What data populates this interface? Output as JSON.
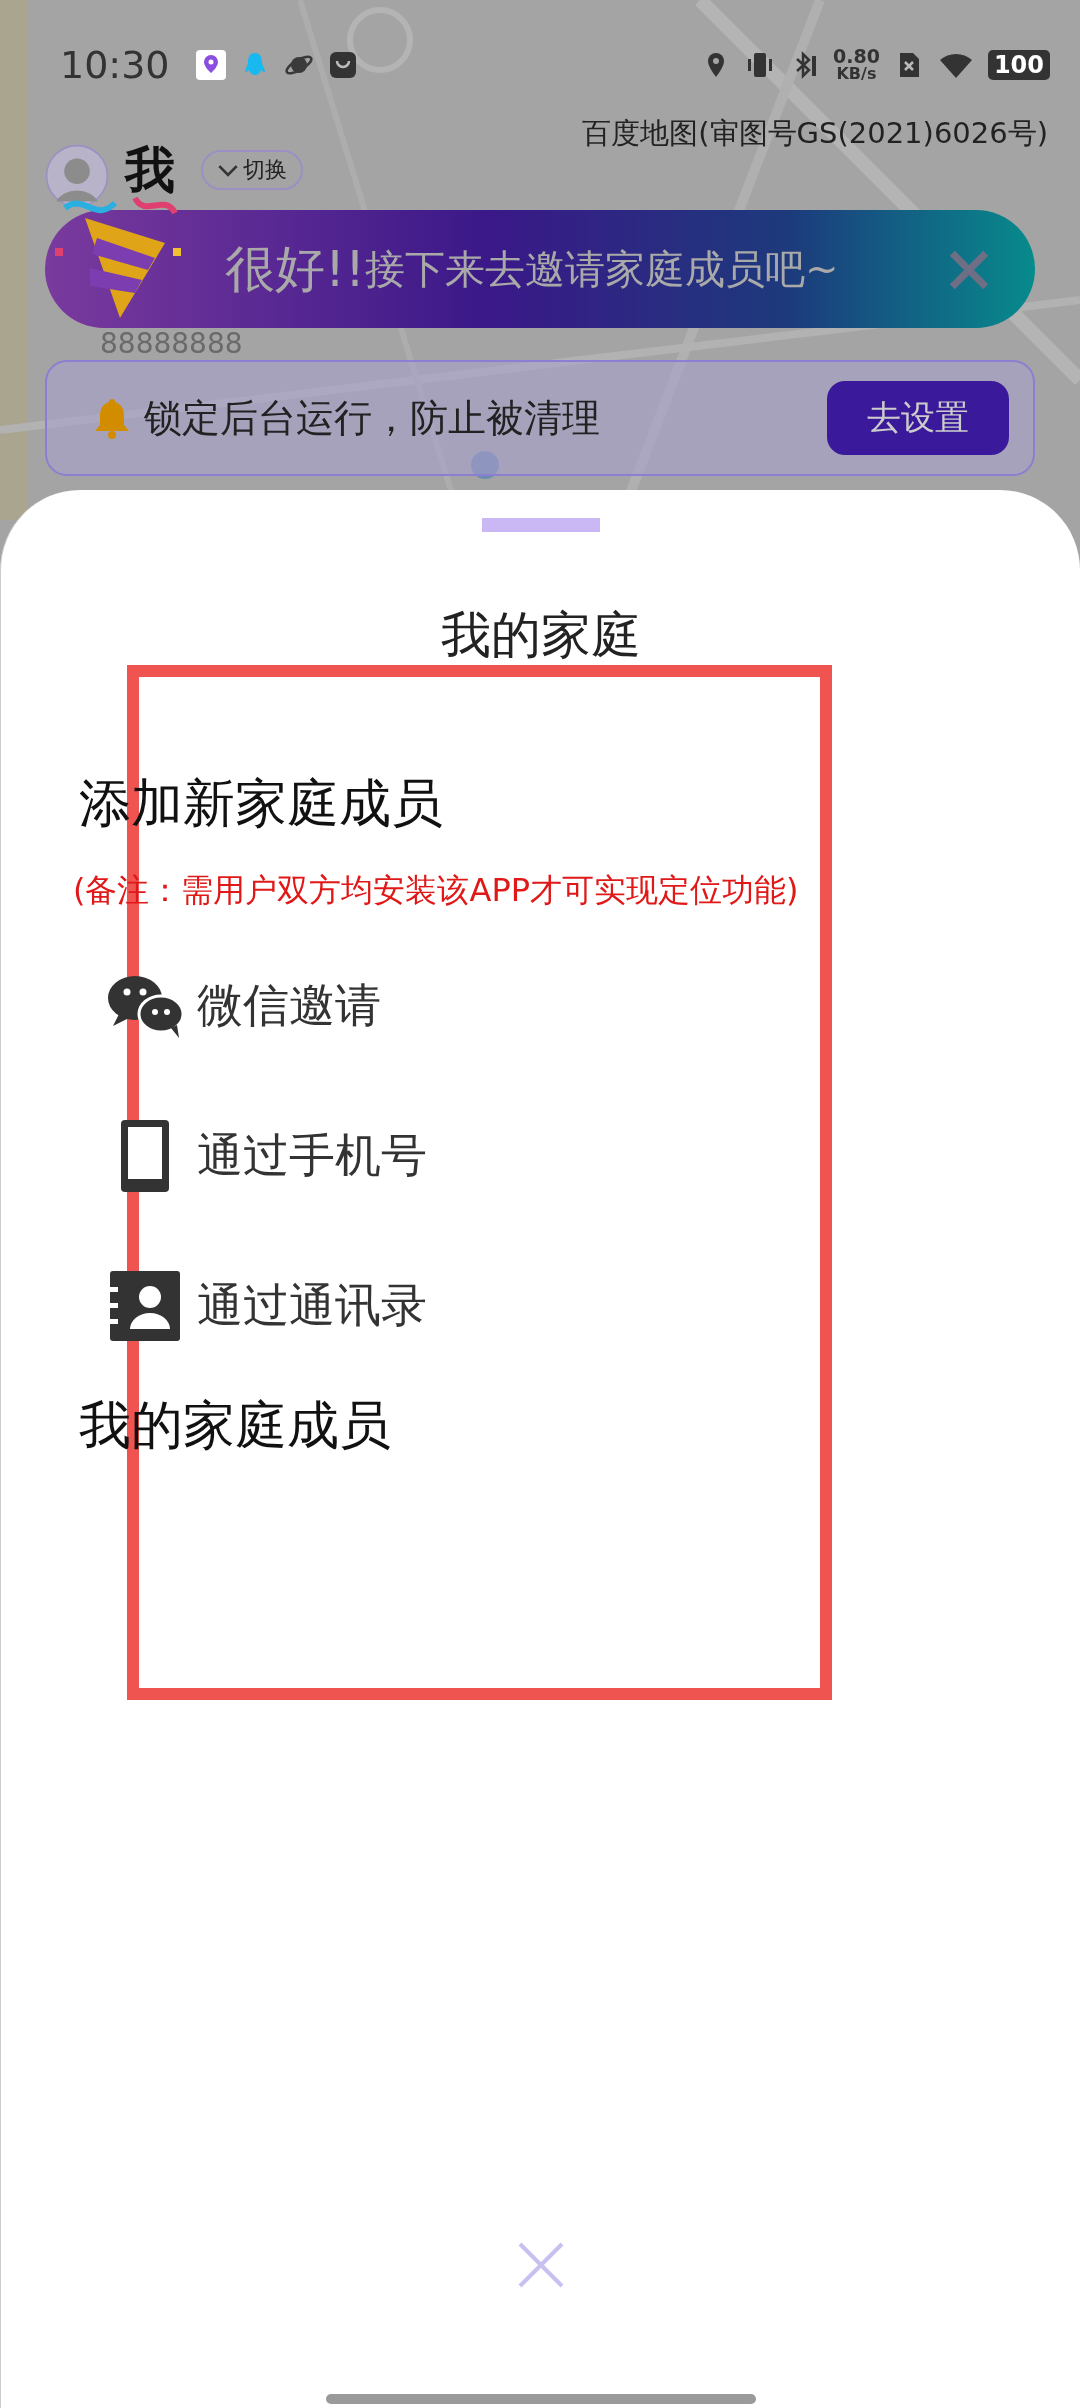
{
  "status_bar": {
    "time": "10:30",
    "net_speed": "0.80",
    "net_unit": "KB/s",
    "battery": "100"
  },
  "map": {
    "attribution": "百度地图(审图号GS(2021)6026号)"
  },
  "profile": {
    "name": "我",
    "switch_label": "切换",
    "phone": "88888888"
  },
  "toast": {
    "exclaim": "很好!!",
    "message": "接下来去邀请家庭成员吧~"
  },
  "notice": {
    "text": "锁定后台运行，防止被清理",
    "button": "去设置"
  },
  "sheet": {
    "title": "我的家庭",
    "add_section": "添加新家庭成员",
    "note": "(备注：需用户双方均安装该APP才可实现定位功能)",
    "invite_options": [
      {
        "kind": "wechat",
        "label": "微信邀请"
      },
      {
        "kind": "phone",
        "label": "通过手机号"
      },
      {
        "kind": "contacts",
        "label": "通过通讯录"
      }
    ],
    "members_section": "我的家庭成员"
  }
}
